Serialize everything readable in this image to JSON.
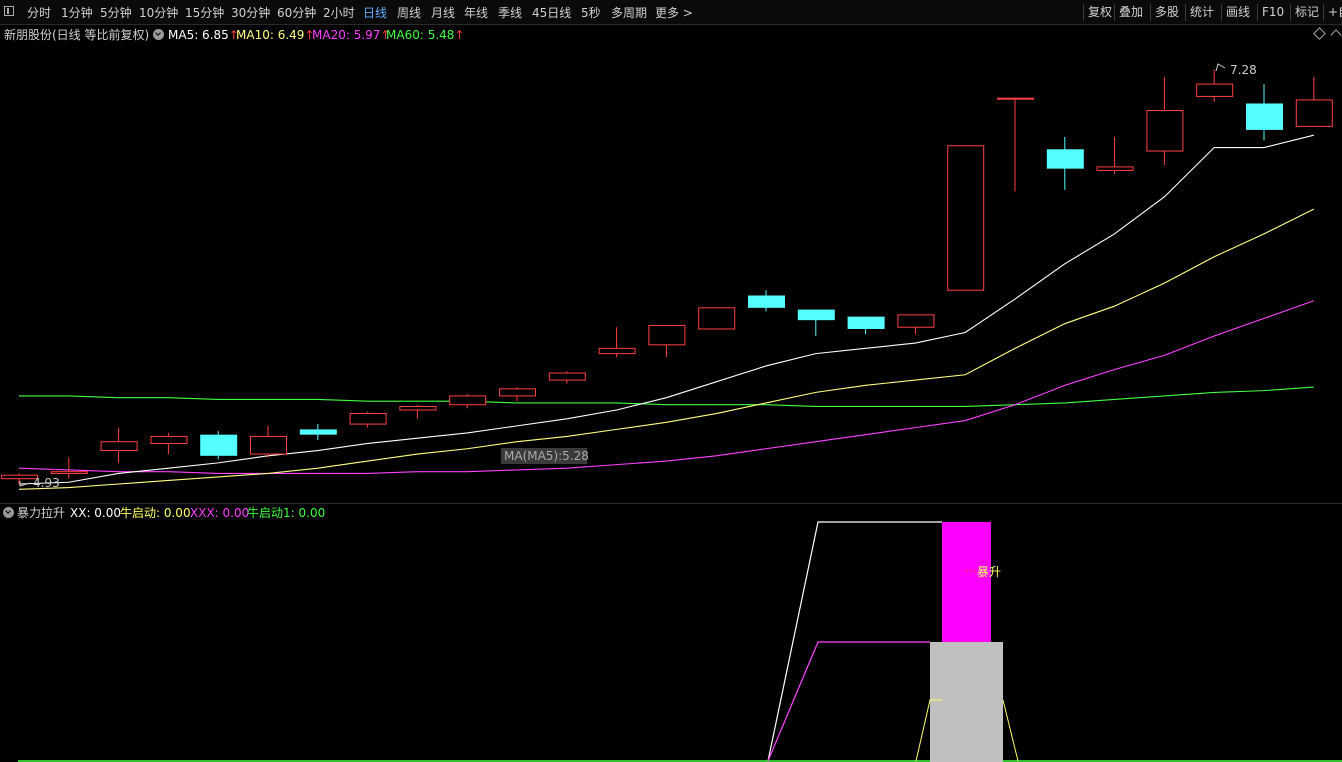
{
  "toolbar": {
    "periods": [
      "分时",
      "1分钟",
      "5分钟",
      "10分钟",
      "15分钟",
      "30分钟",
      "60分钟",
      "2小时",
      "日线",
      "周线",
      "月线",
      "年线",
      "季线",
      "45日线",
      "5秒",
      "多周期",
      "更多 >"
    ],
    "active_period": "日线",
    "right_buttons": [
      "复权",
      "叠加",
      "多股",
      "统计",
      "画线",
      "F10",
      "标记",
      "+自"
    ]
  },
  "main_chart": {
    "title": "新朋股份(日线 等比前复权)",
    "ma": [
      {
        "label": "MA5: 6.85",
        "arrow": "↑",
        "color": "#ffffff"
      },
      {
        "label": "MA10: 6.49",
        "arrow": "↑",
        "color": "#ffff80"
      },
      {
        "label": "MA20: 5.97",
        "arrow": "↑",
        "color": "#ff40ff"
      },
      {
        "label": "MA60: 5.48",
        "arrow": "↑",
        "color": "#40ff40"
      }
    ],
    "high_label": "7.28",
    "low_label": "4.93",
    "ma_tooltip": "MA(MA5):5.28",
    "colors": {
      "up": "#ff4040",
      "down": "#54ffff",
      "ma5": "#ffffff",
      "ma10": "#ffff80",
      "ma20": "#ff40ff",
      "ma60": "#40ff40"
    },
    "candles": [
      {
        "o": 4.96,
        "c": 4.98,
        "h": 4.99,
        "l": 4.93
      },
      {
        "o": 4.99,
        "c": 5.0,
        "h": 5.08,
        "l": 4.96
      },
      {
        "o": 5.12,
        "c": 5.17,
        "h": 5.25,
        "l": 5.05
      },
      {
        "o": 5.16,
        "c": 5.2,
        "h": 5.22,
        "l": 5.1
      },
      {
        "o": 5.21,
        "c": 5.09,
        "h": 5.23,
        "l": 5.07
      },
      {
        "o": 5.1,
        "c": 5.2,
        "h": 5.26,
        "l": 5.08
      },
      {
        "o": 5.24,
        "c": 5.21,
        "h": 5.27,
        "l": 5.18
      },
      {
        "o": 5.27,
        "c": 5.33,
        "h": 5.34,
        "l": 5.25
      },
      {
        "o": 5.35,
        "c": 5.37,
        "h": 5.38,
        "l": 5.3
      },
      {
        "o": 5.38,
        "c": 5.43,
        "h": 5.44,
        "l": 5.36
      },
      {
        "o": 5.43,
        "c": 5.47,
        "h": 5.48,
        "l": 5.4
      },
      {
        "o": 5.52,
        "c": 5.56,
        "h": 5.57,
        "l": 5.5
      },
      {
        "o": 5.67,
        "c": 5.7,
        "h": 5.82,
        "l": 5.65
      },
      {
        "o": 5.72,
        "c": 5.83,
        "h": 5.83,
        "l": 5.65
      },
      {
        "o": 5.81,
        "c": 5.93,
        "h": 5.93,
        "l": 5.81
      },
      {
        "o": 6.0,
        "c": 5.93,
        "h": 6.03,
        "l": 5.91
      },
      {
        "o": 5.92,
        "c": 5.86,
        "h": 5.92,
        "l": 5.77
      },
      {
        "o": 5.88,
        "c": 5.81,
        "h": 5.88,
        "l": 5.78
      },
      {
        "o": 5.82,
        "c": 5.89,
        "h": 5.89,
        "l": 5.78
      },
      {
        "o": 6.03,
        "c": 6.85,
        "h": 6.85,
        "l": 6.03
      },
      {
        "o": 7.12,
        "c": 7.12,
        "h": 7.12,
        "l": 6.59
      },
      {
        "o": 6.83,
        "c": 6.72,
        "h": 6.9,
        "l": 6.6
      },
      {
        "o": 6.71,
        "c": 6.73,
        "h": 6.9,
        "l": 6.69
      },
      {
        "o": 6.82,
        "c": 7.05,
        "h": 7.24,
        "l": 6.74
      },
      {
        "o": 7.13,
        "c": 7.2,
        "h": 7.28,
        "l": 7.1
      },
      {
        "o": 7.09,
        "c": 6.94,
        "h": 7.2,
        "l": 6.88
      },
      {
        "o": 6.96,
        "c": 7.11,
        "h": 7.24,
        "l": 6.96
      }
    ],
    "ma5": [
      4.93,
      4.94,
      4.99,
      5.02,
      5.05,
      5.09,
      5.12,
      5.16,
      5.19,
      5.22,
      5.26,
      5.3,
      5.35,
      5.42,
      5.51,
      5.6,
      5.67,
      5.7,
      5.73,
      5.79,
      5.98,
      6.18,
      6.35,
      6.56,
      6.84,
      6.84,
      6.91
    ],
    "ma10": [
      4.9,
      4.91,
      4.93,
      4.95,
      4.97,
      4.99,
      5.02,
      5.06,
      5.1,
      5.13,
      5.17,
      5.2,
      5.24,
      5.28,
      5.33,
      5.39,
      5.45,
      5.49,
      5.52,
      5.55,
      5.7,
      5.84,
      5.94,
      6.07,
      6.22,
      6.35,
      6.49
    ],
    "ma20": [
      5.02,
      5.01,
      5.0,
      5.0,
      4.99,
      4.99,
      4.99,
      4.99,
      5.0,
      5.0,
      5.01,
      5.02,
      5.04,
      5.06,
      5.09,
      5.13,
      5.17,
      5.21,
      5.25,
      5.29,
      5.38,
      5.49,
      5.58,
      5.66,
      5.77,
      5.87,
      5.97
    ],
    "ma60": [
      5.43,
      5.43,
      5.42,
      5.42,
      5.41,
      5.41,
      5.41,
      5.4,
      5.4,
      5.4,
      5.39,
      5.39,
      5.39,
      5.38,
      5.38,
      5.38,
      5.37,
      5.37,
      5.37,
      5.37,
      5.38,
      5.39,
      5.41,
      5.43,
      5.45,
      5.46,
      5.48
    ]
  },
  "indicator": {
    "name": "暴力拉升",
    "values": [
      {
        "label": "XX: 0.00",
        "color": "#ffffff"
      },
      {
        "label": "牛启动: 0.00",
        "color": "#ffff60"
      },
      {
        "label": "XXX: 0.00",
        "color": "#ff40ff"
      },
      {
        "label": "牛启动1: 0.00",
        "color": "#40ff40"
      }
    ],
    "signal_label": "暴升"
  }
}
